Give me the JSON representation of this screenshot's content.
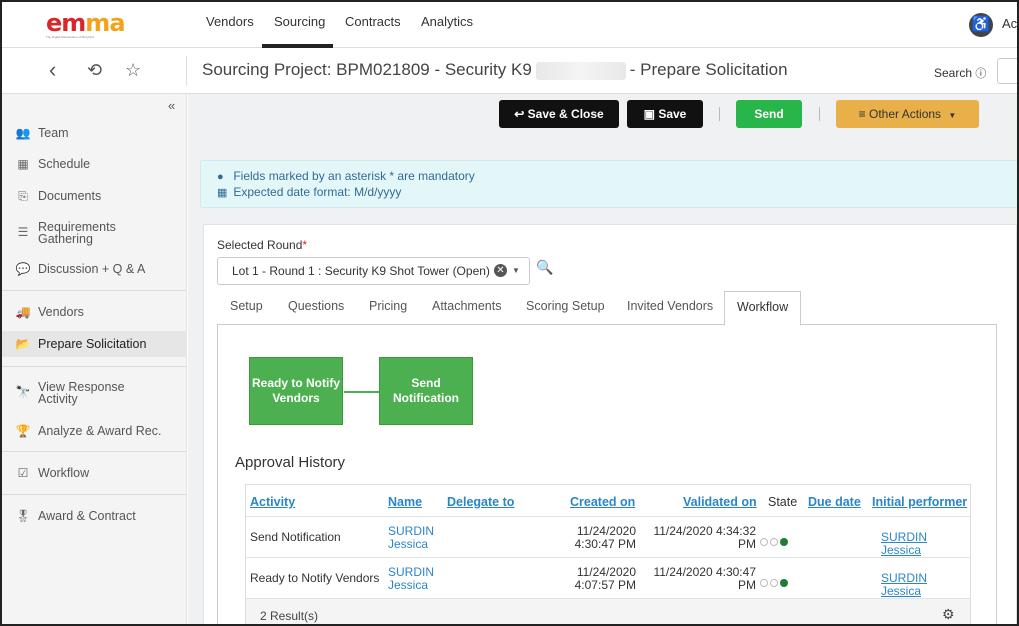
{
  "nav": {
    "logo": {
      "e": "e",
      "m1": "m",
      "m2": "m",
      "a": "a",
      "tagline": "The Digital Marketplace of Maryland"
    },
    "items": [
      "Vendors",
      "Sourcing",
      "Contracts",
      "Analytics"
    ],
    "active": "Sourcing",
    "account_label": "Ac"
  },
  "titlebar": {
    "title_prefix": "Sourcing Project: BPM021809 - Security K9",
    "title_suffix": "- Prepare Solicitation",
    "search_label": "Search",
    "back_icon": "‹",
    "history_icon": "⟲",
    "star_icon": "☆"
  },
  "sidebar": {
    "collapse_icon": "«",
    "items": [
      {
        "label": "Team",
        "icon": "team-icon"
      },
      {
        "label": "Schedule",
        "icon": "calendar-icon"
      },
      {
        "label": "Documents",
        "icon": "document-icon"
      },
      {
        "label": "Requirements Gathering",
        "line1": "Requirements",
        "line2": "Gathering",
        "icon": "list-icon"
      },
      {
        "label": "Discussion + Q & A",
        "icon": "chat-icon"
      },
      {
        "label": "Vendors",
        "icon": "truck-icon"
      },
      {
        "label": "Prepare Solicitation",
        "icon": "folder-open-icon"
      },
      {
        "label": "View Response Activity",
        "line1": "View Response",
        "line2": "Activity",
        "icon": "binoculars-icon"
      },
      {
        "label": "Analyze & Award Rec.",
        "icon": "trophy-icon"
      },
      {
        "label": "Workflow",
        "icon": "checkbox-icon"
      },
      {
        "label": "Award & Contract",
        "icon": "award-icon"
      }
    ],
    "active": "Prepare Solicitation"
  },
  "actions": {
    "save_close": "Save & Close",
    "save": "Save",
    "send": "Send",
    "other_actions": "Other Actions"
  },
  "info": {
    "line1": "Fields marked by an asterisk * are mandatory",
    "line2": "Expected date format: M/d/yyyy"
  },
  "round": {
    "label": "Selected Round",
    "value": "Lot 1 - Round 1 : Security K9 Shot Tower (Open)"
  },
  "tabs": [
    "Setup",
    "Questions",
    "Pricing",
    "Attachments",
    "Scoring Setup",
    "Invited Vendors",
    "Workflow"
  ],
  "active_tab": "Workflow",
  "workflow": {
    "step1": "Ready to Notify Vendors",
    "step2": "Send Notification"
  },
  "approval_history": {
    "title": "Approval History",
    "columns": [
      "Activity",
      "Name",
      "Delegate to",
      "Created on",
      "Validated on",
      "State",
      "Due date",
      "Initial performer"
    ],
    "rows": [
      {
        "activity": "Send Notification",
        "name_first": "SURDIN",
        "name_last": "Jessica",
        "delegate": "",
        "created_date": "11/24/2020",
        "created_time": "4:30:47 PM",
        "validated_line1": "11/24/2020 4:34:32",
        "validated_line2": "PM",
        "state_step": 3,
        "due": "",
        "performer": "SURDIN Jessica"
      },
      {
        "activity": "Ready to Notify Vendors",
        "name_first": "SURDIN",
        "name_last": "Jessica",
        "delegate": "",
        "created_date": "11/24/2020",
        "created_time": "4:07:57 PM",
        "validated_line1": "11/24/2020 4:30:47",
        "validated_line2": "PM",
        "state_step": 3,
        "due": "",
        "performer": "SURDIN Jessica"
      }
    ],
    "result_count": "2 Result(s)"
  },
  "colors": {
    "accent_blue": "#2a86c9",
    "send_green": "#28b54a",
    "workflow_green": "#4caf50",
    "other_actions_orange": "#e9b04a"
  }
}
